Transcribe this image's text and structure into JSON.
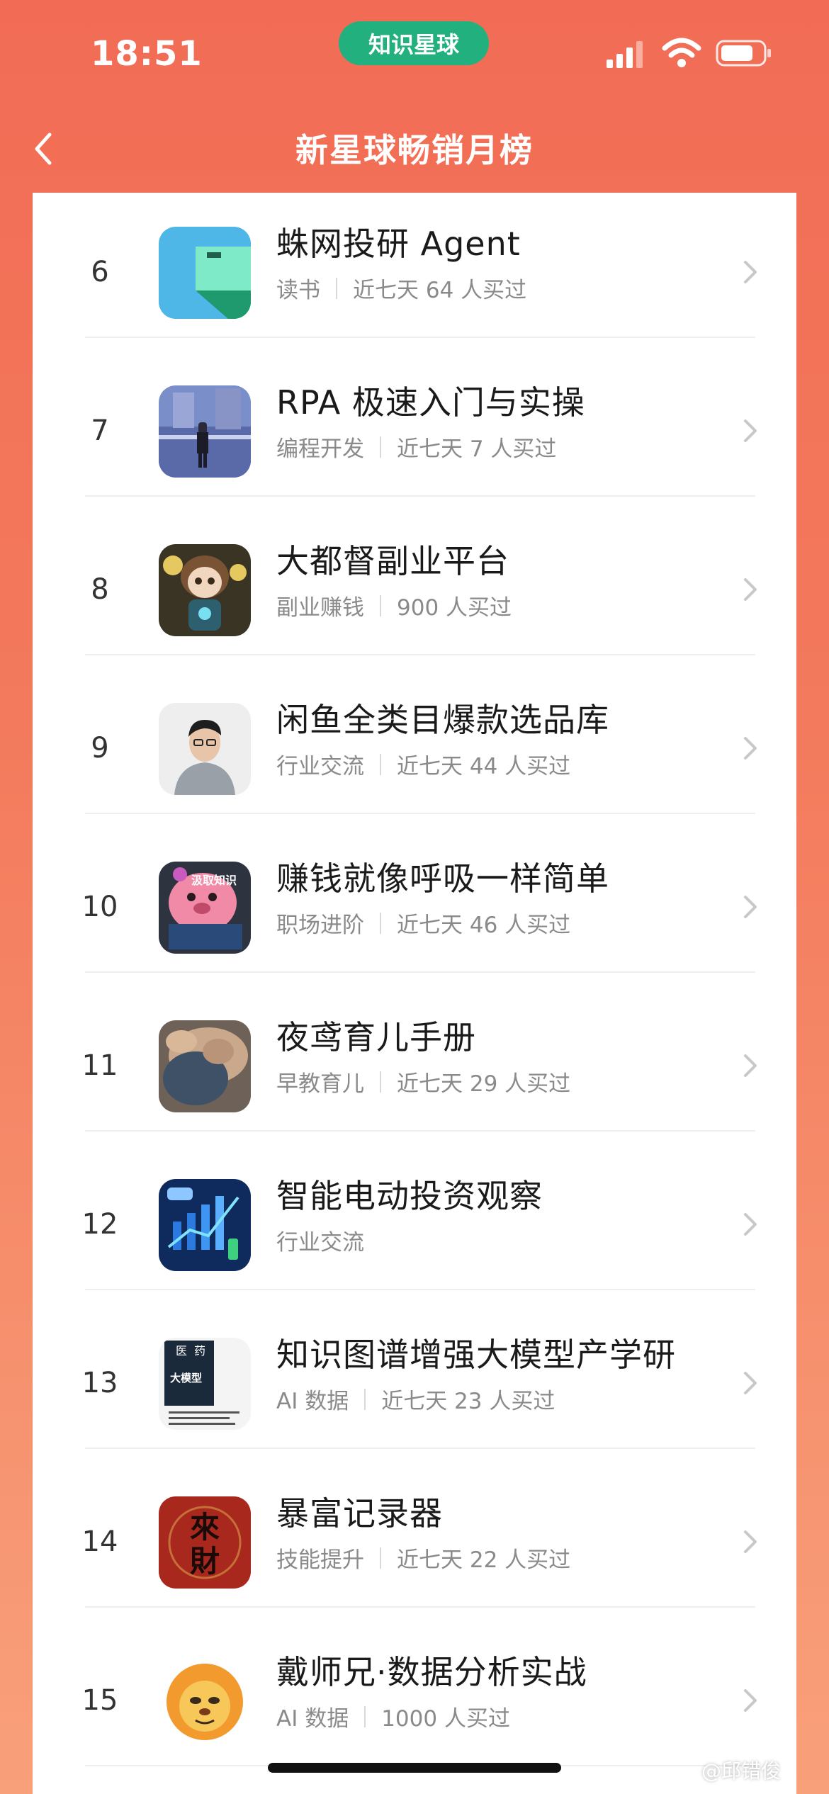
{
  "status_bar": {
    "time": "18:51",
    "app_badge": "知识星球",
    "icons": [
      "cellular-signal-icon",
      "wifi-icon",
      "battery-icon"
    ]
  },
  "nav": {
    "title": "新星球畅销月榜",
    "back_icon": "back-chevron-icon"
  },
  "list": [
    {
      "rank": "6",
      "title": "蛛网投研 Agent",
      "category": "读书",
      "stat": "近七天 64 人买过"
    },
    {
      "rank": "7",
      "title": "RPA 极速入门与实操",
      "category": "编程开发",
      "stat": "近七天 7 人买过"
    },
    {
      "rank": "8",
      "title": "大都督副业平台",
      "category": "副业赚钱",
      "stat": "900 人买过"
    },
    {
      "rank": "9",
      "title": "闲鱼全类目爆款选品库",
      "category": "行业交流",
      "stat": "近七天 44 人买过"
    },
    {
      "rank": "10",
      "title": "赚钱就像呼吸一样简单",
      "category": "职场进阶",
      "stat": "近七天 46 人买过"
    },
    {
      "rank": "11",
      "title": "夜鸢育儿手册",
      "category": "早教育儿",
      "stat": "近七天 29 人买过"
    },
    {
      "rank": "12",
      "title": "智能电动投资观察",
      "category": "行业交流",
      "stat": ""
    },
    {
      "rank": "13",
      "title": "知识图谱增强大模型产学研",
      "category": "AI 数据",
      "stat": "近七天 23 人买过"
    },
    {
      "rank": "14",
      "title": "暴富记录器",
      "category": "技能提升",
      "stat": "近七天 22 人买过"
    },
    {
      "rank": "15",
      "title": "戴师兄·数据分析实战",
      "category": "AI 数据",
      "stat": "1000 人买过"
    }
  ],
  "thumb_text": {
    "r10_badge": "汲取知识",
    "r13_line1": "医",
    "r13_line2": "药",
    "r13_line3": "大模型",
    "r14_line1": "來",
    "r14_line2": "財"
  },
  "watermark": "@邱错俊",
  "colors": {
    "header_bg": "#f26c55",
    "badge_green": "#23b07f",
    "text_primary": "#1a1a1a",
    "text_secondary": "#8a8a8a"
  }
}
